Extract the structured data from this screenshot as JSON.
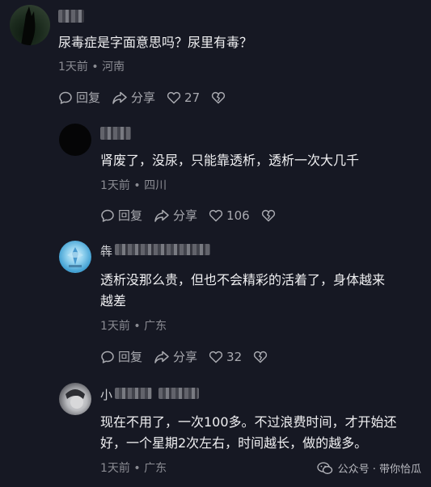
{
  "comments": [
    {
      "text": "尿毒症是字面意思吗？尿里有毒？",
      "meta": "1天前 • 河南",
      "reply_label": "回复",
      "share_label": "分享",
      "likes": "27"
    },
    {
      "text": "肾废了，没尿，只能靠透析，透析一次大几千",
      "meta": "1天前 • 四川",
      "reply_label": "回复",
      "share_label": "分享",
      "likes": "106"
    },
    {
      "name_visible_char": "犇",
      "text": "透析没那么贵，但也不会精彩的活着了，身体越来\n越差",
      "meta": "1天前 • 广东",
      "reply_label": "回复",
      "share_label": "分享",
      "likes": "32"
    },
    {
      "name_visible_char": "小",
      "text": "现在不用了，一次100多。不过浪费时间，才开始还\n好，一个星期2次左右，时间越长，做的越多。",
      "meta": "1天前 • 广东"
    }
  ],
  "watermark": "公众号 · 带你恰瓜",
  "colors": {
    "background": "#161823",
    "text": "#f0f0f2",
    "meta": "#8b8c93"
  },
  "icons": [
    "comment-icon",
    "share-icon",
    "heart-icon",
    "broken-heart-icon",
    "wechat-icon"
  ]
}
